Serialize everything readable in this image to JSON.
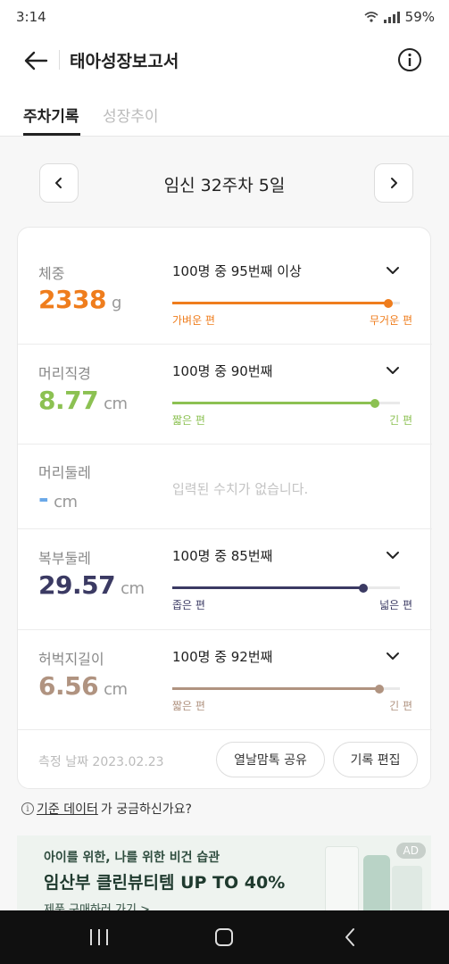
{
  "status": {
    "time": "3:14",
    "battery": "59%"
  },
  "header": {
    "title": "태아성장보고서"
  },
  "tabs": [
    {
      "label": "주차기록",
      "active": true
    },
    {
      "label": "성장추이",
      "active": false
    }
  ],
  "week": {
    "label": "임신 32주차 5일"
  },
  "measurements": [
    {
      "label": "체중",
      "value": "2338",
      "unit": "g",
      "color": "#ef7d1d",
      "rank": "100명 중 95번째 이상",
      "left_label": "가벼운 편",
      "right_label": "무거운 편",
      "percentile": 0.95
    },
    {
      "label": "머리직경",
      "value": "8.77",
      "unit": "cm",
      "color": "#8cc152",
      "rank": "100명 중 90번째",
      "left_label": "짧은 편",
      "right_label": "긴 편",
      "percentile": 0.89
    },
    {
      "label": "머리둘레",
      "value": "-",
      "unit": "cm",
      "color": "#6aa8e8",
      "empty_message": "입력된 수치가 없습니다."
    },
    {
      "label": "복부둘레",
      "value": "29.57",
      "unit": "cm",
      "color": "#3b3a63",
      "rank": "100명 중 85번째",
      "left_label": "좁은 편",
      "right_label": "넓은 편",
      "percentile": 0.84
    },
    {
      "label": "허벅지길이",
      "value": "6.56",
      "unit": "cm",
      "color": "#b09380",
      "rank": "100명 중 92번째",
      "left_label": "짧은 편",
      "right_label": "긴 편",
      "percentile": 0.91
    }
  ],
  "footer": {
    "measure_date": "측정 날짜 2023.02.23",
    "share_label": "열날맘톡 공유",
    "edit_label": "기록 편집"
  },
  "help": {
    "link_text": "기준 데이터",
    "suffix_text": "가 궁금하신가요?"
  },
  "ad": {
    "subtitle": "아이를 위한, 나를 위한 비건 습관",
    "title": "임산부 클린뷰티템 UP TO 40%",
    "link": "제품 구매하러 가기 >",
    "badge": "AD"
  }
}
